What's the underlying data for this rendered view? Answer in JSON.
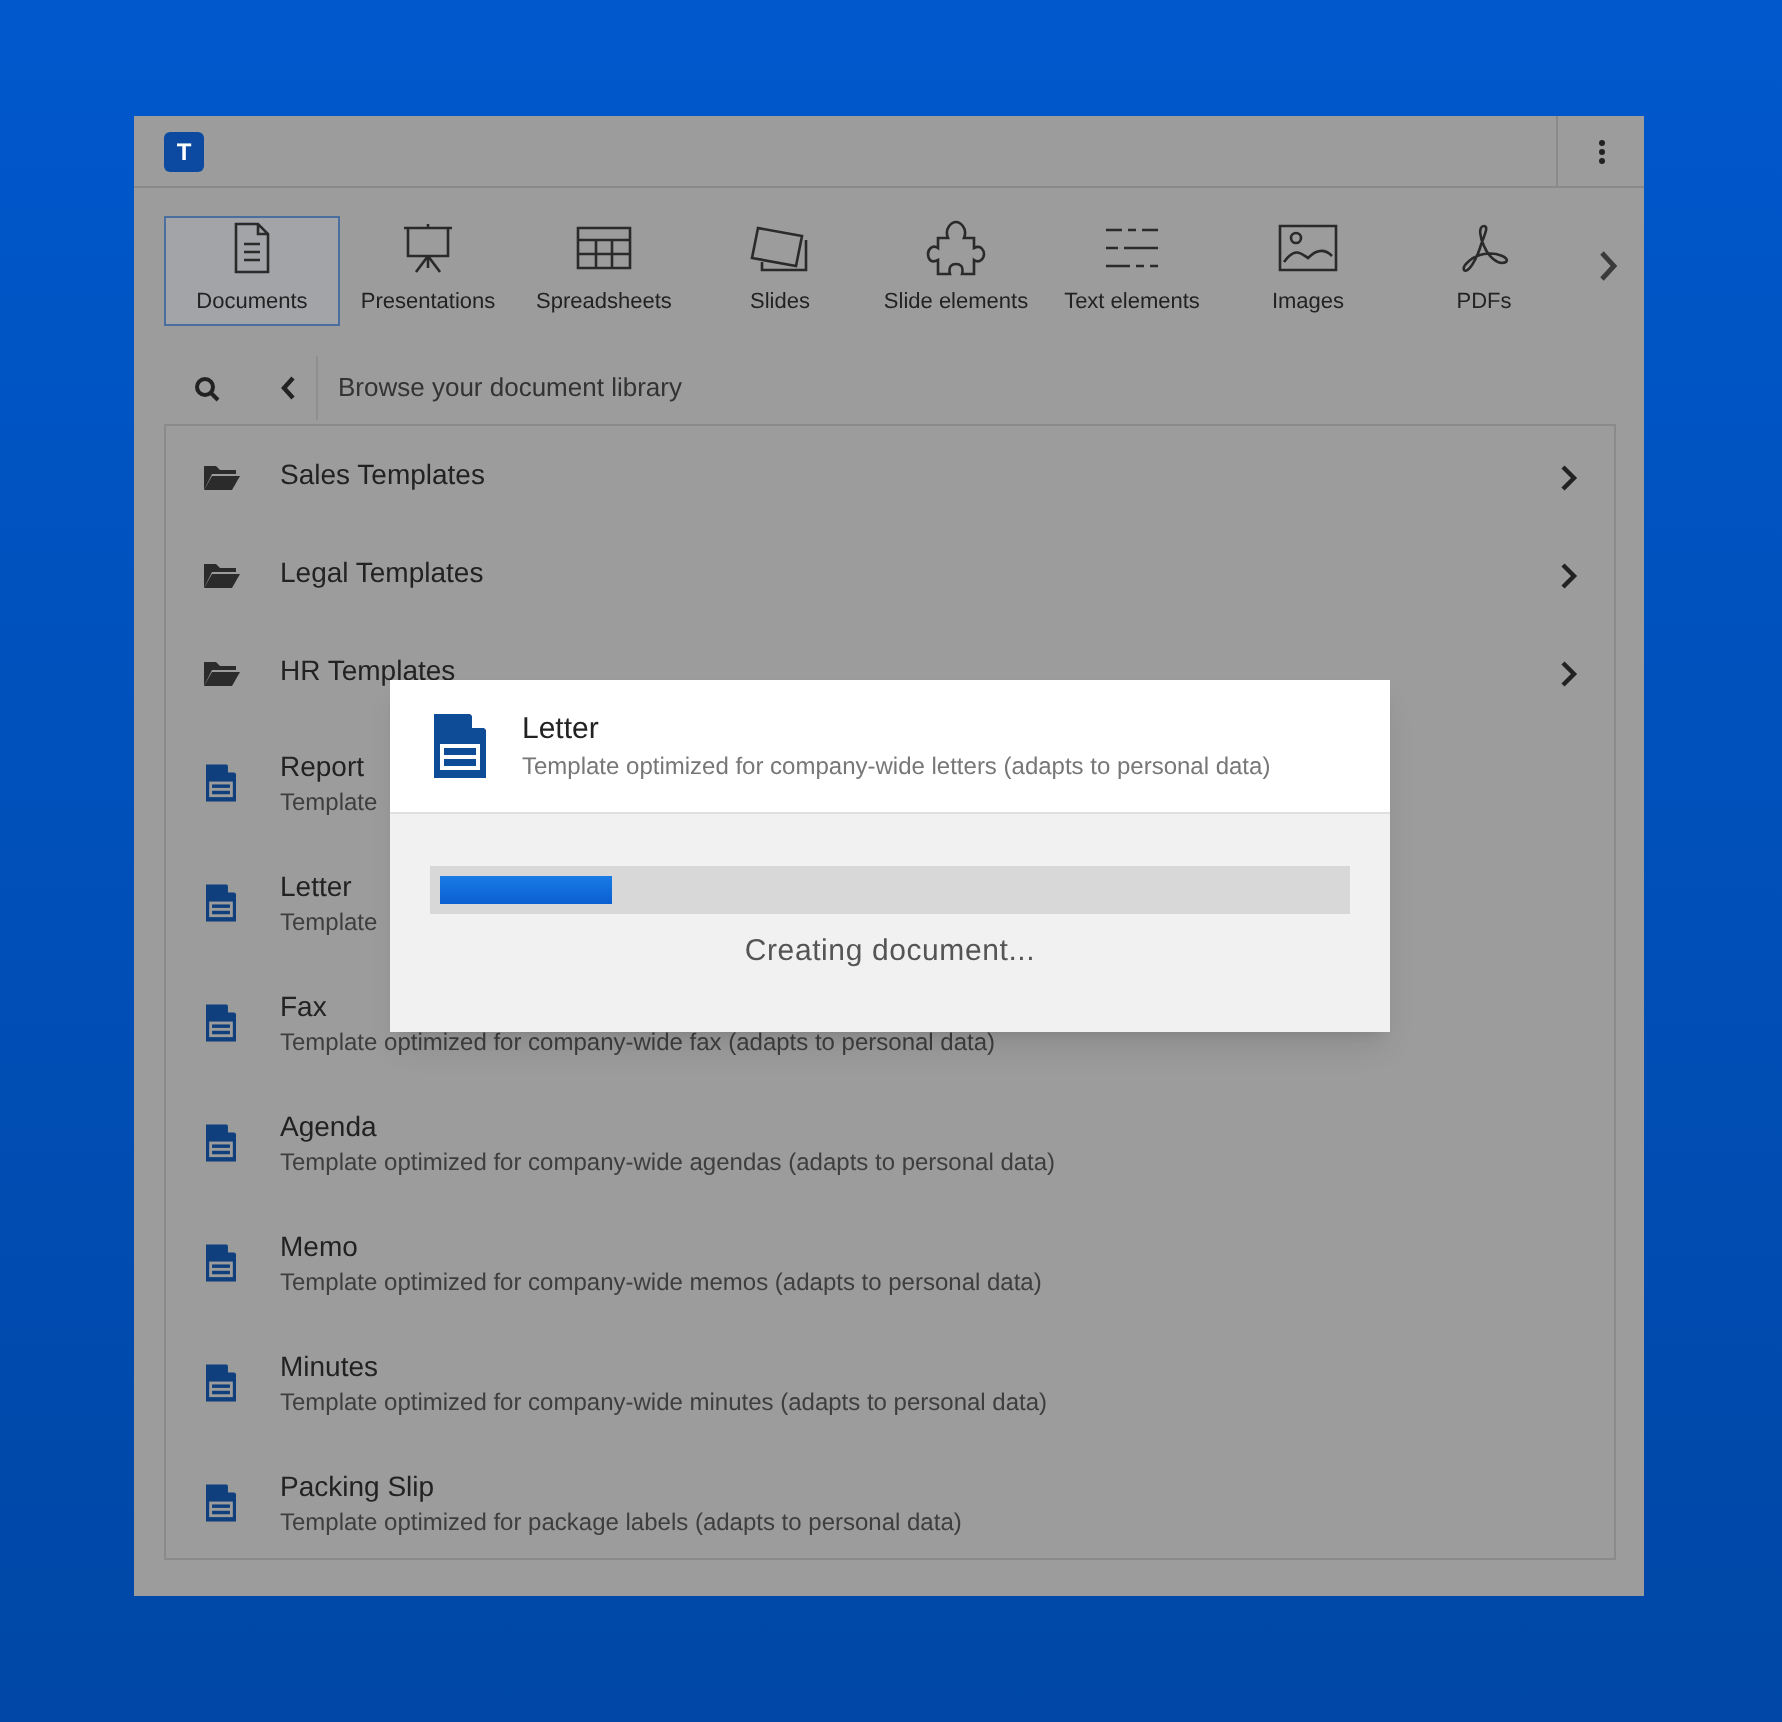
{
  "app": {
    "logo": "T"
  },
  "tabs": [
    {
      "label": "Documents",
      "selected": true
    },
    {
      "label": "Presentations",
      "selected": false
    },
    {
      "label": "Spreadsheets",
      "selected": false
    },
    {
      "label": "Slides",
      "selected": false
    },
    {
      "label": "Slide elements",
      "selected": false
    },
    {
      "label": "Text elements",
      "selected": false
    },
    {
      "label": "Images",
      "selected": false
    },
    {
      "label": "PDFs",
      "selected": false
    }
  ],
  "breadcrumb": {
    "text": "Browse your document library"
  },
  "items": [
    {
      "kind": "folder",
      "title": "Sales Templates"
    },
    {
      "kind": "folder",
      "title": "Legal Templates"
    },
    {
      "kind": "folder",
      "title": "HR Templates"
    },
    {
      "kind": "document",
      "title": "Report",
      "description": "Template"
    },
    {
      "kind": "document",
      "title": "Letter",
      "description": "Template"
    },
    {
      "kind": "document",
      "title": "Fax",
      "description": "Template optimized for company-wide fax (adapts to personal data)"
    },
    {
      "kind": "document",
      "title": "Agenda",
      "description": "Template optimized for company-wide agendas (adapts to personal data)"
    },
    {
      "kind": "document",
      "title": "Memo",
      "description": "Template optimized for company-wide memos (adapts to personal data)"
    },
    {
      "kind": "document",
      "title": "Minutes",
      "description": "Template optimized for company-wide minutes (adapts to personal data)"
    },
    {
      "kind": "document",
      "title": "Packing Slip",
      "description": "Template optimized for package labels (adapts to personal data)"
    }
  ],
  "dialog": {
    "title": "Letter",
    "description": "Template optimized for company-wide letters (adapts to personal data)",
    "level": 0.19,
    "status": "Creating document..."
  }
}
